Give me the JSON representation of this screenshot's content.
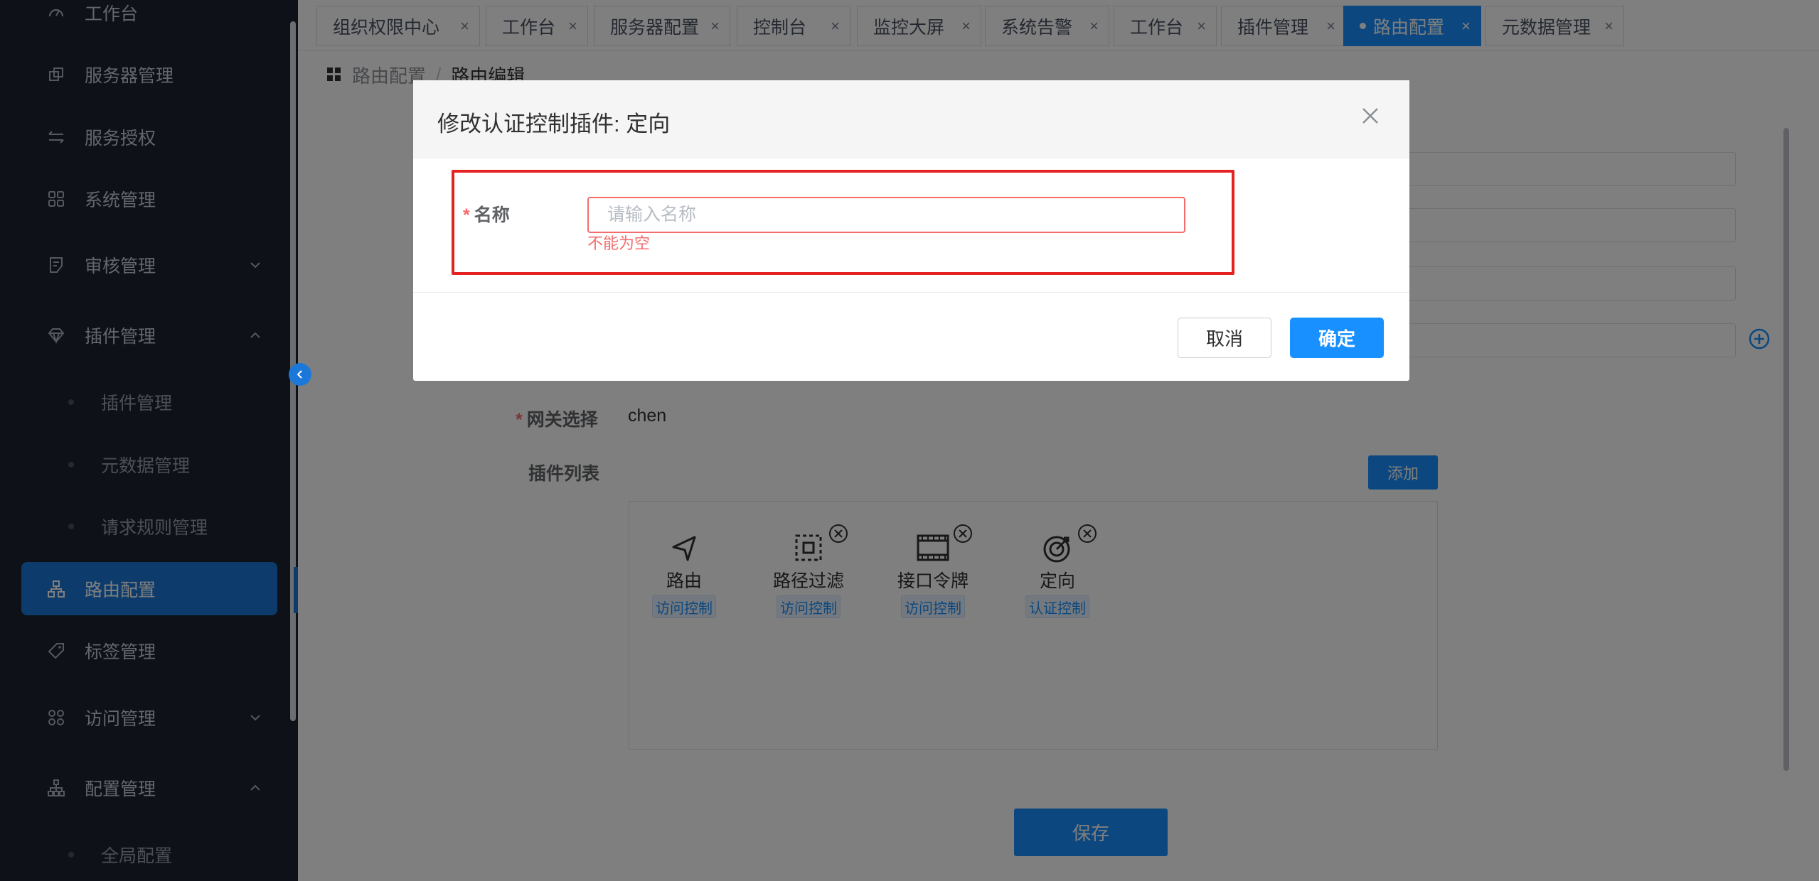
{
  "sidebar": {
    "items": [
      {
        "label": "工作台",
        "icon": "dashboard-icon"
      },
      {
        "label": "服务器管理",
        "icon": "server-icon"
      },
      {
        "label": "服务授权",
        "icon": "swap-icon"
      },
      {
        "label": "系统管理",
        "icon": "grid-icon"
      },
      {
        "label": "审核管理",
        "icon": "audit-icon"
      },
      {
        "label": "插件管理",
        "icon": "diamond-icon"
      }
    ],
    "plugin_sub": [
      "插件管理",
      "元数据管理",
      "请求规则管理"
    ],
    "items2": [
      {
        "label": "路由配置",
        "icon": "route-icon"
      },
      {
        "label": "标签管理",
        "icon": "tag-icon"
      },
      {
        "label": "访问管理",
        "icon": "apps-icon"
      },
      {
        "label": "配置管理",
        "icon": "tree-icon"
      }
    ],
    "config_sub": [
      "全局配置"
    ]
  },
  "tabs": [
    "组织权限中心",
    "工作台",
    "服务器配置",
    "控制台",
    "监控大屏",
    "系统告警",
    "工作台",
    "插件管理",
    "路由配置",
    "元数据管理"
  ],
  "active_tab": "路由配置",
  "breadcrumb": {
    "parent": "路由配置",
    "separator": "/",
    "current": "路由编辑"
  },
  "form": {
    "gateway_label": "网关选择",
    "gateway_value": "chen",
    "plugin_list_label": "插件列表",
    "add_button": "添加",
    "plugins": [
      {
        "name": "路由",
        "tag": "访问控制",
        "icon": "navigation-icon",
        "closable": false
      },
      {
        "name": "路径过滤",
        "tag": "访问控制",
        "icon": "filter-icon",
        "closable": true
      },
      {
        "name": "接口令牌",
        "tag": "访问控制",
        "icon": "film-icon",
        "closable": true
      },
      {
        "name": "定向",
        "tag": "认证控制",
        "icon": "target-icon",
        "closable": true
      }
    ],
    "save_button": "保存"
  },
  "modal": {
    "title": "修改认证控制插件: 定向",
    "name_label": "名称",
    "name_placeholder": "请输入名称",
    "name_value": "",
    "error_text": "不能为空",
    "cancel": "取消",
    "confirm": "确定"
  },
  "colors": {
    "primary": "#1890ff",
    "sidebar_bg": "#1c2230",
    "error": "#f56c6c",
    "highlight_frame": "#e52222"
  }
}
